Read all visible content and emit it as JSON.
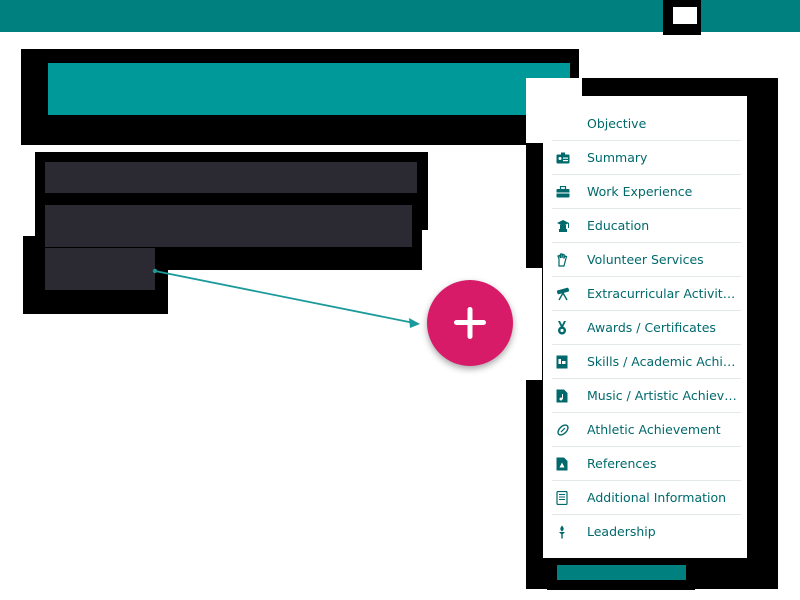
{
  "colors": {
    "header": "#00807f",
    "title_panel": "#009999",
    "text_block": "#2b2a33",
    "add_button": "#d81b69",
    "menu_text": "#00696b",
    "connector": "#1a9a9a"
  },
  "add_button": {
    "icon": "plus-icon"
  },
  "menu": {
    "items": [
      {
        "label": "Objective",
        "icon": "target-icon"
      },
      {
        "label": "Summary",
        "icon": "id-card-icon"
      },
      {
        "label": "Work Experience",
        "icon": "briefcase-icon"
      },
      {
        "label": "Education",
        "icon": "graduation-icon"
      },
      {
        "label": "Volunteer Services",
        "icon": "hand-icon"
      },
      {
        "label": "Extracurricular Activities",
        "icon": "telescope-icon"
      },
      {
        "label": "Awards / Certificates",
        "icon": "medal-icon"
      },
      {
        "label": "Skills / Academic Achievements",
        "icon": "skills-book-icon"
      },
      {
        "label": "Music / Artistic Achievements",
        "icon": "music-file-icon"
      },
      {
        "label": "Athletic Achievement",
        "icon": "football-icon"
      },
      {
        "label": "References",
        "icon": "references-file-icon"
      },
      {
        "label": "Additional Information",
        "icon": "document-icon"
      },
      {
        "label": "Leadership",
        "icon": "torch-icon"
      }
    ]
  }
}
